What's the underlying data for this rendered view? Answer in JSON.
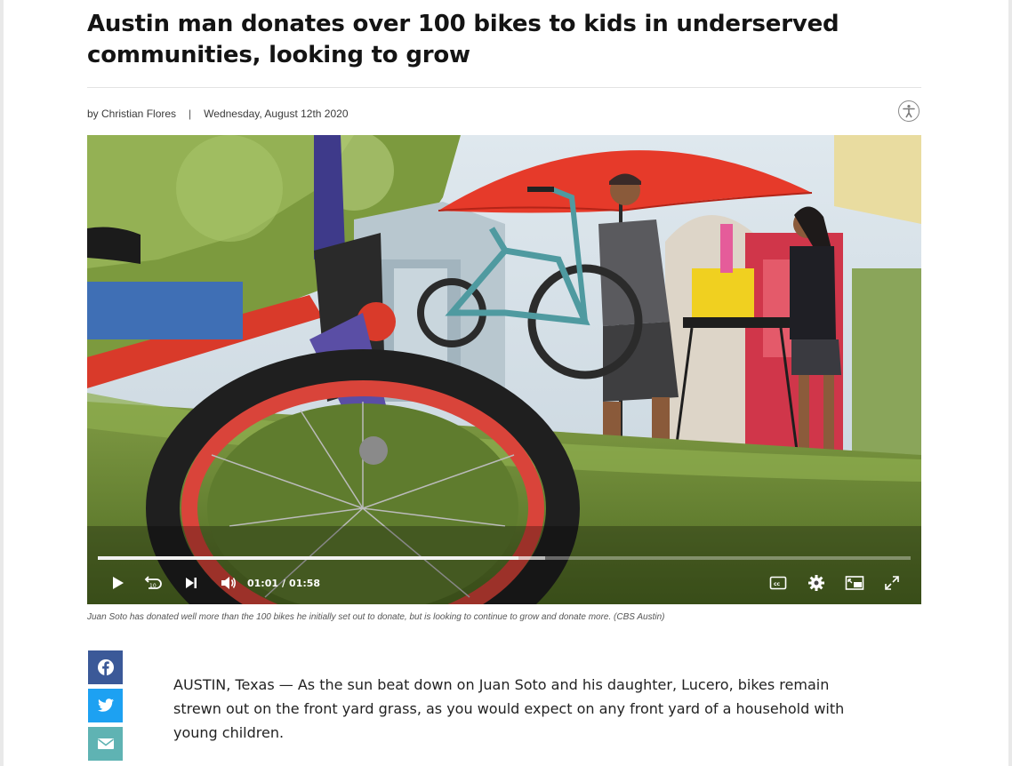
{
  "article": {
    "headline": "Austin man donates over 100 bikes to kids in underserved communities, looking to grow",
    "byline": {
      "author": "by Christian Flores",
      "separator": "|",
      "date": "Wednesday, August 12th 2020"
    },
    "caption": "Juan Soto has donated well more than the 100 bikes he initially set out to donate, but is looking to continue to grow and donate more. (CBS Austin)",
    "paragraph_1": "AUSTIN, Texas — As the sun beat down on Juan Soto and his daughter, Lucero, bikes remain strewn out on the front yard grass, as you would expect on any front yard of a household with young children."
  },
  "video": {
    "current_time": "01:01",
    "time_separator": "/",
    "duration": "01:58",
    "progress_fraction": 0.517,
    "buffered_fraction": 0.55,
    "controls": [
      "play-icon",
      "replay-10-icon",
      "skip-next-icon",
      "volume-icon",
      "closed-captions-icon",
      "settings-icon",
      "picture-in-picture-icon",
      "fullscreen-icon"
    ]
  },
  "share": {
    "items": [
      "facebook-icon",
      "twitter-icon",
      "email-icon"
    ]
  },
  "colors": {
    "facebook": "#3b5998",
    "twitter": "#1da1f2",
    "email": "#5fb3b3"
  }
}
